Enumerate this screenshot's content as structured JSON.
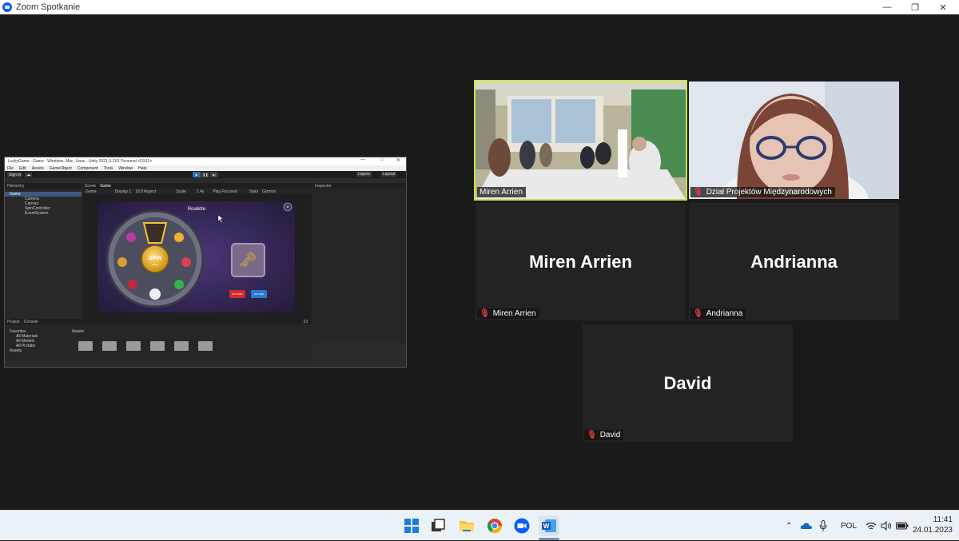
{
  "window": {
    "title": "Zoom Spotkanie"
  },
  "shared_screen": {
    "window_title": "LuckyGame - Game - Windows, Mac, Linux - Unity 2021.3.11f1 Personal <DX11>",
    "menu": [
      "File",
      "Edit",
      "Assets",
      "GameObject",
      "Component",
      "Tools",
      "Window",
      "Help"
    ],
    "sign_in": "Sign in",
    "layers": "Layers",
    "layout": "Layout",
    "hierarchy": {
      "tab": "Hierarchy",
      "root": "Game",
      "items": [
        "Camera",
        "Canvas",
        "SpinController",
        "EventSystem"
      ]
    },
    "game_tabs": [
      "Scene",
      "Game"
    ],
    "game_toolbar": {
      "mode": "Game",
      "display": "Display 1",
      "aspect": "16:9 Aspect",
      "scale_label": "Scale",
      "scale_value": "1.4x",
      "play_focused": "Play Focused",
      "stats": "Stats",
      "gizmos": "Gizmos"
    },
    "game": {
      "title": "Roulette",
      "spin_label": "SPIN",
      "spin_sub": "FREE",
      "btn_red": "GET PRIZES",
      "btn_blue": "SPIN FREE"
    },
    "inspector_tab": "Inspector",
    "project": {
      "tabs": [
        "Project",
        "Console"
      ],
      "favorites": "Favorites",
      "fav_items": [
        "All Materials",
        "All Models",
        "All Prefabs"
      ],
      "assets": "Assets",
      "assets_header": "Assets",
      "count": "23"
    }
  },
  "participants": [
    {
      "name": "Miren Arrien",
      "type": "video",
      "active_speaker": true
    },
    {
      "name": "Dział Projektów Międzynarodowych",
      "type": "video",
      "muted": true
    },
    {
      "name": "Miren Arrien",
      "type": "avatar",
      "muted": true
    },
    {
      "name": "Andrianna",
      "type": "avatar",
      "muted": true
    },
    {
      "name": "David",
      "type": "avatar",
      "muted": true
    }
  ],
  "taskbar": {
    "apps": [
      "start-icon",
      "task-view-icon",
      "file-explorer-icon",
      "chrome-icon",
      "zoom-icon",
      "word-icon"
    ],
    "language": "POL",
    "time": "11:41",
    "date": "24.01.2023"
  },
  "colors": {
    "active_speaker_border": "#c5e34a",
    "zoom_blue": "#0b5cff",
    "muted_red": "#e23a3a"
  }
}
